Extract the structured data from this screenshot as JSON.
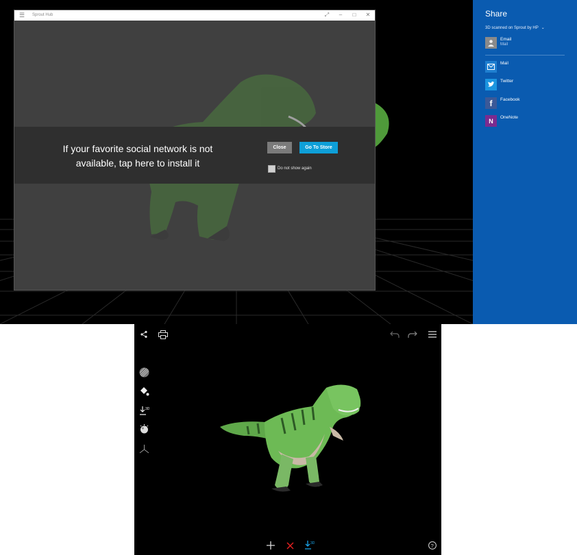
{
  "window": {
    "title": "Sprout Hub",
    "menu_icon": "hamburger-icon",
    "expand_icon": "expand-icon",
    "minimize_icon": "minimize-icon",
    "maximize_icon": "maximize-icon",
    "close_icon": "close-icon"
  },
  "dialog": {
    "message": "If your favorite social network is not available, tap here to install it",
    "close_label": "Close",
    "store_label": "Go To Store",
    "checkbox_label": "Do not show again"
  },
  "share": {
    "title": "Share",
    "source": "3D scanned on Sprout by HP",
    "items": [
      {
        "name": "Email",
        "subtitle": "Mail",
        "icon": "person-icon",
        "color": "#8a8a8a"
      },
      {
        "name": "Mail",
        "icon": "mail-icon",
        "color": "#1f7fd0"
      },
      {
        "name": "Twitter",
        "icon": "twitter-icon",
        "color": "#1b95e0"
      },
      {
        "name": "Facebook",
        "icon": "facebook-icon",
        "color": "#3b5998"
      },
      {
        "name": "OneNote",
        "icon": "onenote-icon",
        "color": "#7b2b8f"
      }
    ]
  },
  "toolbar": {
    "share_icon": "share-icon",
    "print_icon": "print-icon",
    "undo_icon": "undo-icon",
    "redo_icon": "redo-icon",
    "menu_icon": "hamburger-icon",
    "side_tools": [
      "texture-icon",
      "paint-bucket-icon",
      "download-3d-icon",
      "lighting-icon",
      "axes-icon"
    ],
    "bottom_tools": [
      "add-icon",
      "delete-icon",
      "download-3d-icon"
    ],
    "help_icon": "help-icon"
  },
  "colors": {
    "share_pane": "#0a5bb0",
    "store_button": "#0e9fd8",
    "delete_red": "#e02020",
    "accent_blue": "#1aa3e8"
  }
}
